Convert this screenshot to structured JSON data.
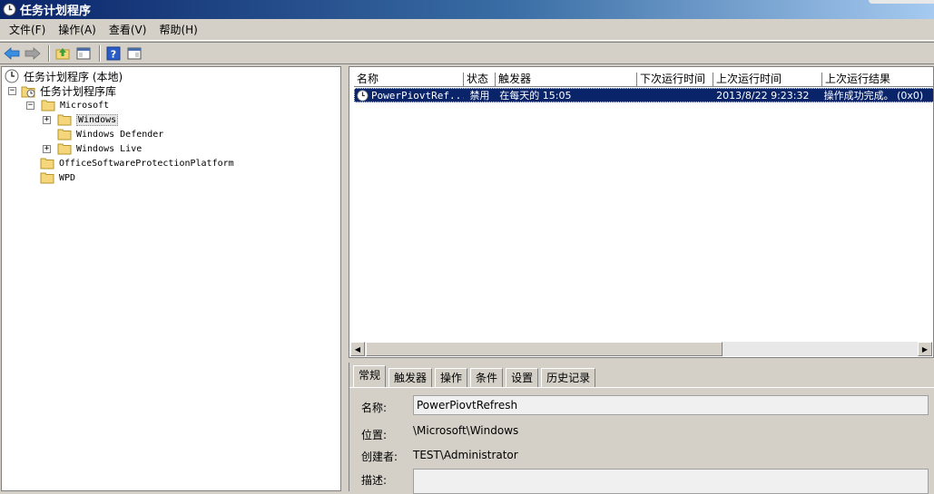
{
  "window": {
    "title": "任务计划程序"
  },
  "menu": [
    "文件(F)",
    "操作(A)",
    "查看(V)",
    "帮助(H)"
  ],
  "toolbar": {
    "icons": [
      "back-arrow-icon",
      "forward-arrow-icon",
      "up-folder-icon",
      "show-hide-console-tree-icon",
      "help-icon",
      "show-hide-action-pane-icon"
    ]
  },
  "tree": {
    "root": "任务计划程序 (本地)",
    "library": "任务计划程序库",
    "microsoft": "Microsoft",
    "windows": "Windows",
    "windows_defender": "Windows Defender",
    "windows_live": "Windows Live",
    "ospp": "OfficeSoftwareProtectionPlatform",
    "wpd": "WPD",
    "expand_plus": "+",
    "collapse_minus": "−"
  },
  "list": {
    "columns": [
      "名称",
      "状态",
      "触发器",
      "下次运行时间",
      "上次运行时间",
      "上次运行结果"
    ],
    "rows": [
      {
        "name": "PowerPiovtRef...",
        "status": "禁用",
        "trigger": "在每天的 15:05",
        "next_run": "",
        "last_run": "2013/8/22 9:23:32",
        "last_result": "操作成功完成。 (0x0)"
      }
    ]
  },
  "scrollbar": {
    "left_arrow": "◀",
    "right_arrow": "▶"
  },
  "detail": {
    "tabs": [
      "常规",
      "触发器",
      "操作",
      "条件",
      "设置",
      "历史记录"
    ],
    "name_label": "名称:",
    "name_value": "PowerPiovtRefresh",
    "location_label": "位置:",
    "location_value": "\\Microsoft\\Windows",
    "author_label": "创建者:",
    "author_value": "TEST\\Administrator",
    "description_label": "描述:",
    "description_value": ""
  },
  "colors": {
    "selection": "#0a246a",
    "titlebar_start": "#0a246a",
    "titlebar_end": "#a6caf0",
    "folder": "#f5d67a"
  }
}
